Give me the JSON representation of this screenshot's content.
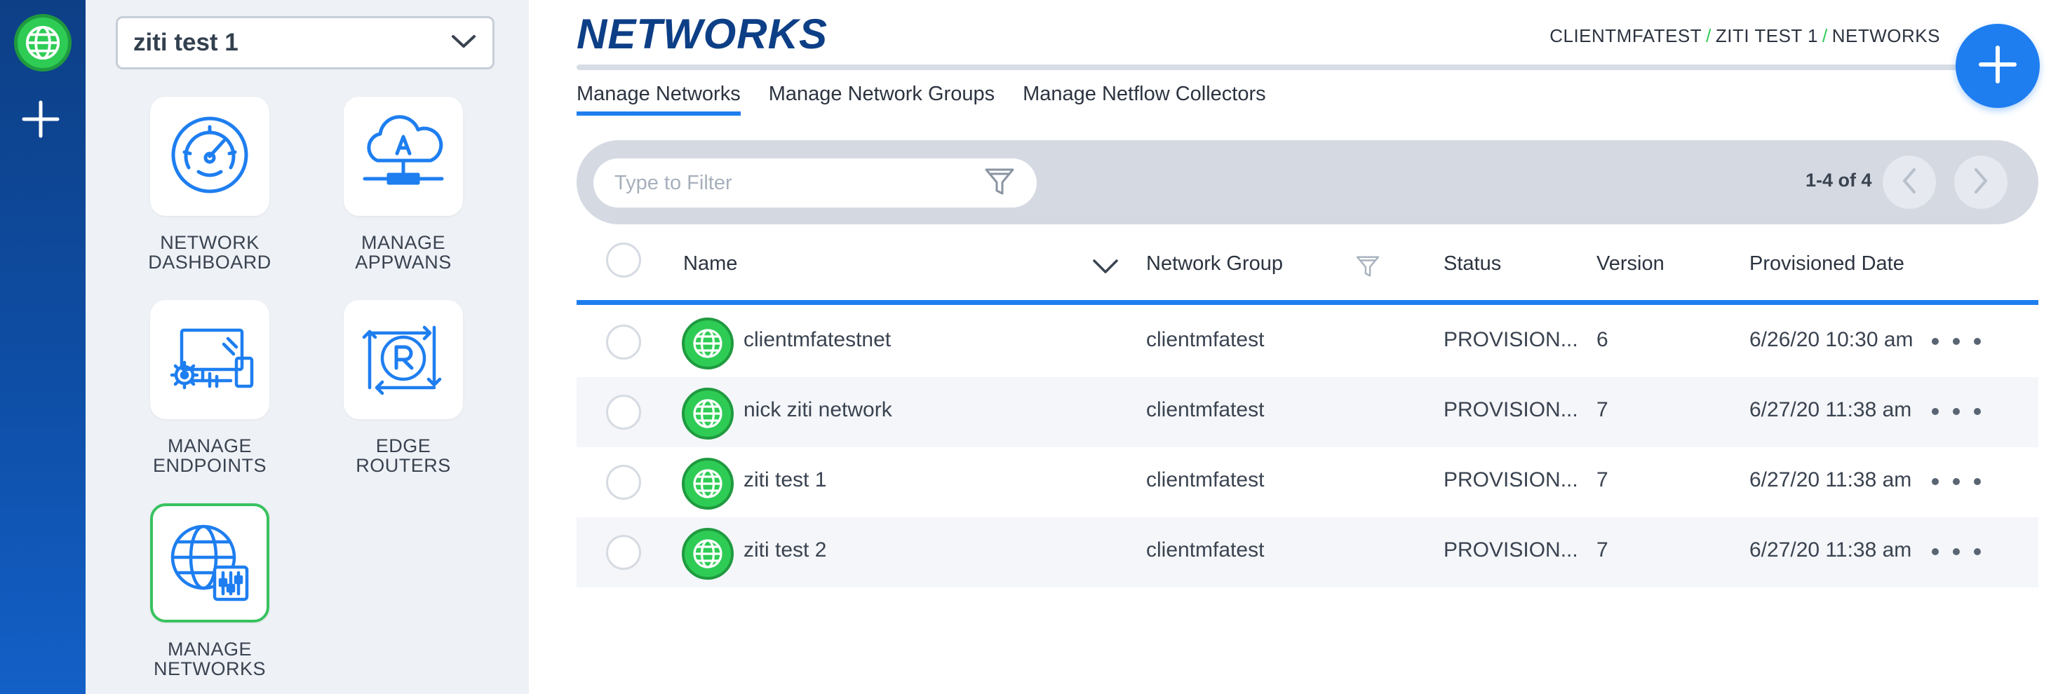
{
  "nav": {
    "selected_network": "ziti test 1",
    "tiles": [
      {
        "line1": "NETWORK",
        "line2": "DASHBOARD"
      },
      {
        "line1": "MANAGE",
        "line2": "APPWANS"
      },
      {
        "line1": "MANAGE",
        "line2": "ENDPOINTS"
      },
      {
        "line1": "EDGE",
        "line2": "ROUTERS"
      },
      {
        "line1": "MANAGE",
        "line2": "NETWORKS"
      }
    ]
  },
  "header": {
    "title": "NETWORKS",
    "breadcrumb": [
      "CLIENTMFATEST",
      "ZITI TEST 1",
      "NETWORKS"
    ],
    "breadcrumb_separator": "/"
  },
  "tabs": [
    "Manage Networks",
    "Manage Network Groups",
    "Manage Netflow Collectors"
  ],
  "filter": {
    "placeholder": "Type to Filter",
    "pager": "1-4 of 4"
  },
  "table": {
    "columns": [
      "Name",
      "Network Group",
      "Status",
      "Version",
      "Provisioned Date"
    ],
    "rows": [
      {
        "name": "clientmfatestnet",
        "group": "clientmfatest",
        "status": "PROVISION...",
        "version": "6",
        "date": "6/26/20 10:30 am"
      },
      {
        "name": "nick ziti network",
        "group": "clientmfatest",
        "status": "PROVISION...",
        "version": "7",
        "date": "6/27/20 11:38 am"
      },
      {
        "name": "ziti test 1",
        "group": "clientmfatest",
        "status": "PROVISION...",
        "version": "7",
        "date": "6/27/20 11:38 am"
      },
      {
        "name": "ziti test 2",
        "group": "clientmfatest",
        "status": "PROVISION...",
        "version": "7",
        "date": "6/27/20 11:38 am"
      }
    ]
  },
  "icons": {
    "rail_top": "globe-icon",
    "rail_add": "plus-icon",
    "select_toggle": "chevron-down-icon",
    "filter": "filter-icon",
    "fab": "plus-icon",
    "row_icon": "globe-icon",
    "row_actions": "more-horizontal-icon"
  },
  "colors": {
    "accent": "#1e7ef0",
    "brand_navy": "#0d3f86",
    "status_green": "#2ecc55",
    "active_tile_border": "#39c25f"
  }
}
